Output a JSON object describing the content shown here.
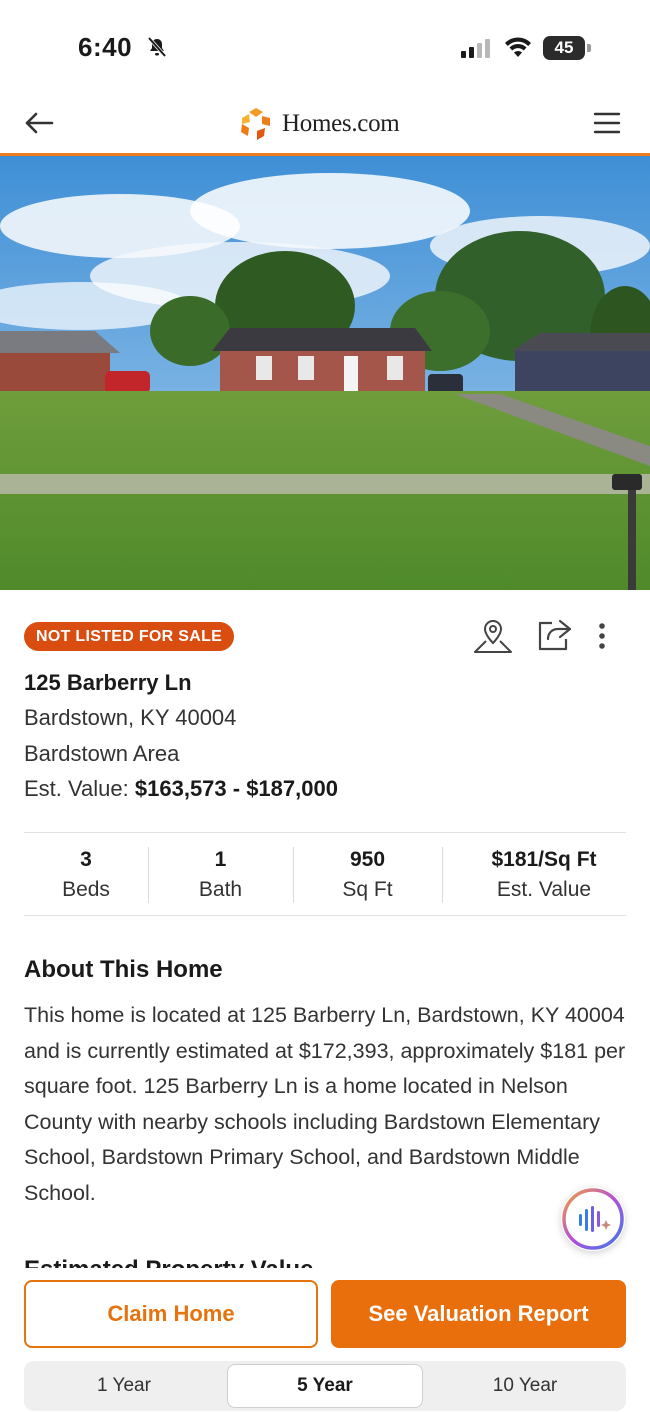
{
  "status_bar": {
    "time": "6:40",
    "battery": "45"
  },
  "header": {
    "brand": "Homes.com",
    "accent_color": "#ee7d1b"
  },
  "listing": {
    "badge": "NOT LISTED FOR SALE",
    "address": "125 Barberry Ln",
    "city_state_zip": "Bardstown, KY 40004",
    "area": "Bardstown Area",
    "est_value_label": "Est. Value:",
    "est_value_range": "$163,573 - $187,000"
  },
  "stats": [
    {
      "value": "3",
      "label": "Beds"
    },
    {
      "value": "1",
      "label": "Bath"
    },
    {
      "value": "950",
      "label": "Sq Ft"
    },
    {
      "value": "$181/Sq Ft",
      "label": "Est. Value"
    }
  ],
  "about": {
    "title": "About This Home",
    "text": "This home is located at 125 Barberry Ln, Bardstown, KY 40004 and is currently estimated at $172,393, approximately $181 per square foot. 125 Barberry Ln is a home located in Nelson County with nearby schools including Bardstown Elementary School, Bardstown Primary School, and Bardstown Middle School."
  },
  "next_section_title": "Estimated Property Value",
  "actions": {
    "claim": "Claim Home",
    "valuation": "See Valuation Report"
  },
  "range_tabs": [
    {
      "label": "1 Year",
      "active": false
    },
    {
      "label": "5 Year",
      "active": true
    },
    {
      "label": "10 Year",
      "active": false
    }
  ],
  "icons": {
    "back": "arrow-left-icon",
    "menu": "hamburger-menu-icon",
    "map": "map-pin-icon",
    "share": "share-icon",
    "more": "more-vertical-icon",
    "ai": "ai-voice-icon"
  },
  "colors": {
    "brand_orange": "#e96f0c",
    "badge_red": "#d94e10"
  }
}
